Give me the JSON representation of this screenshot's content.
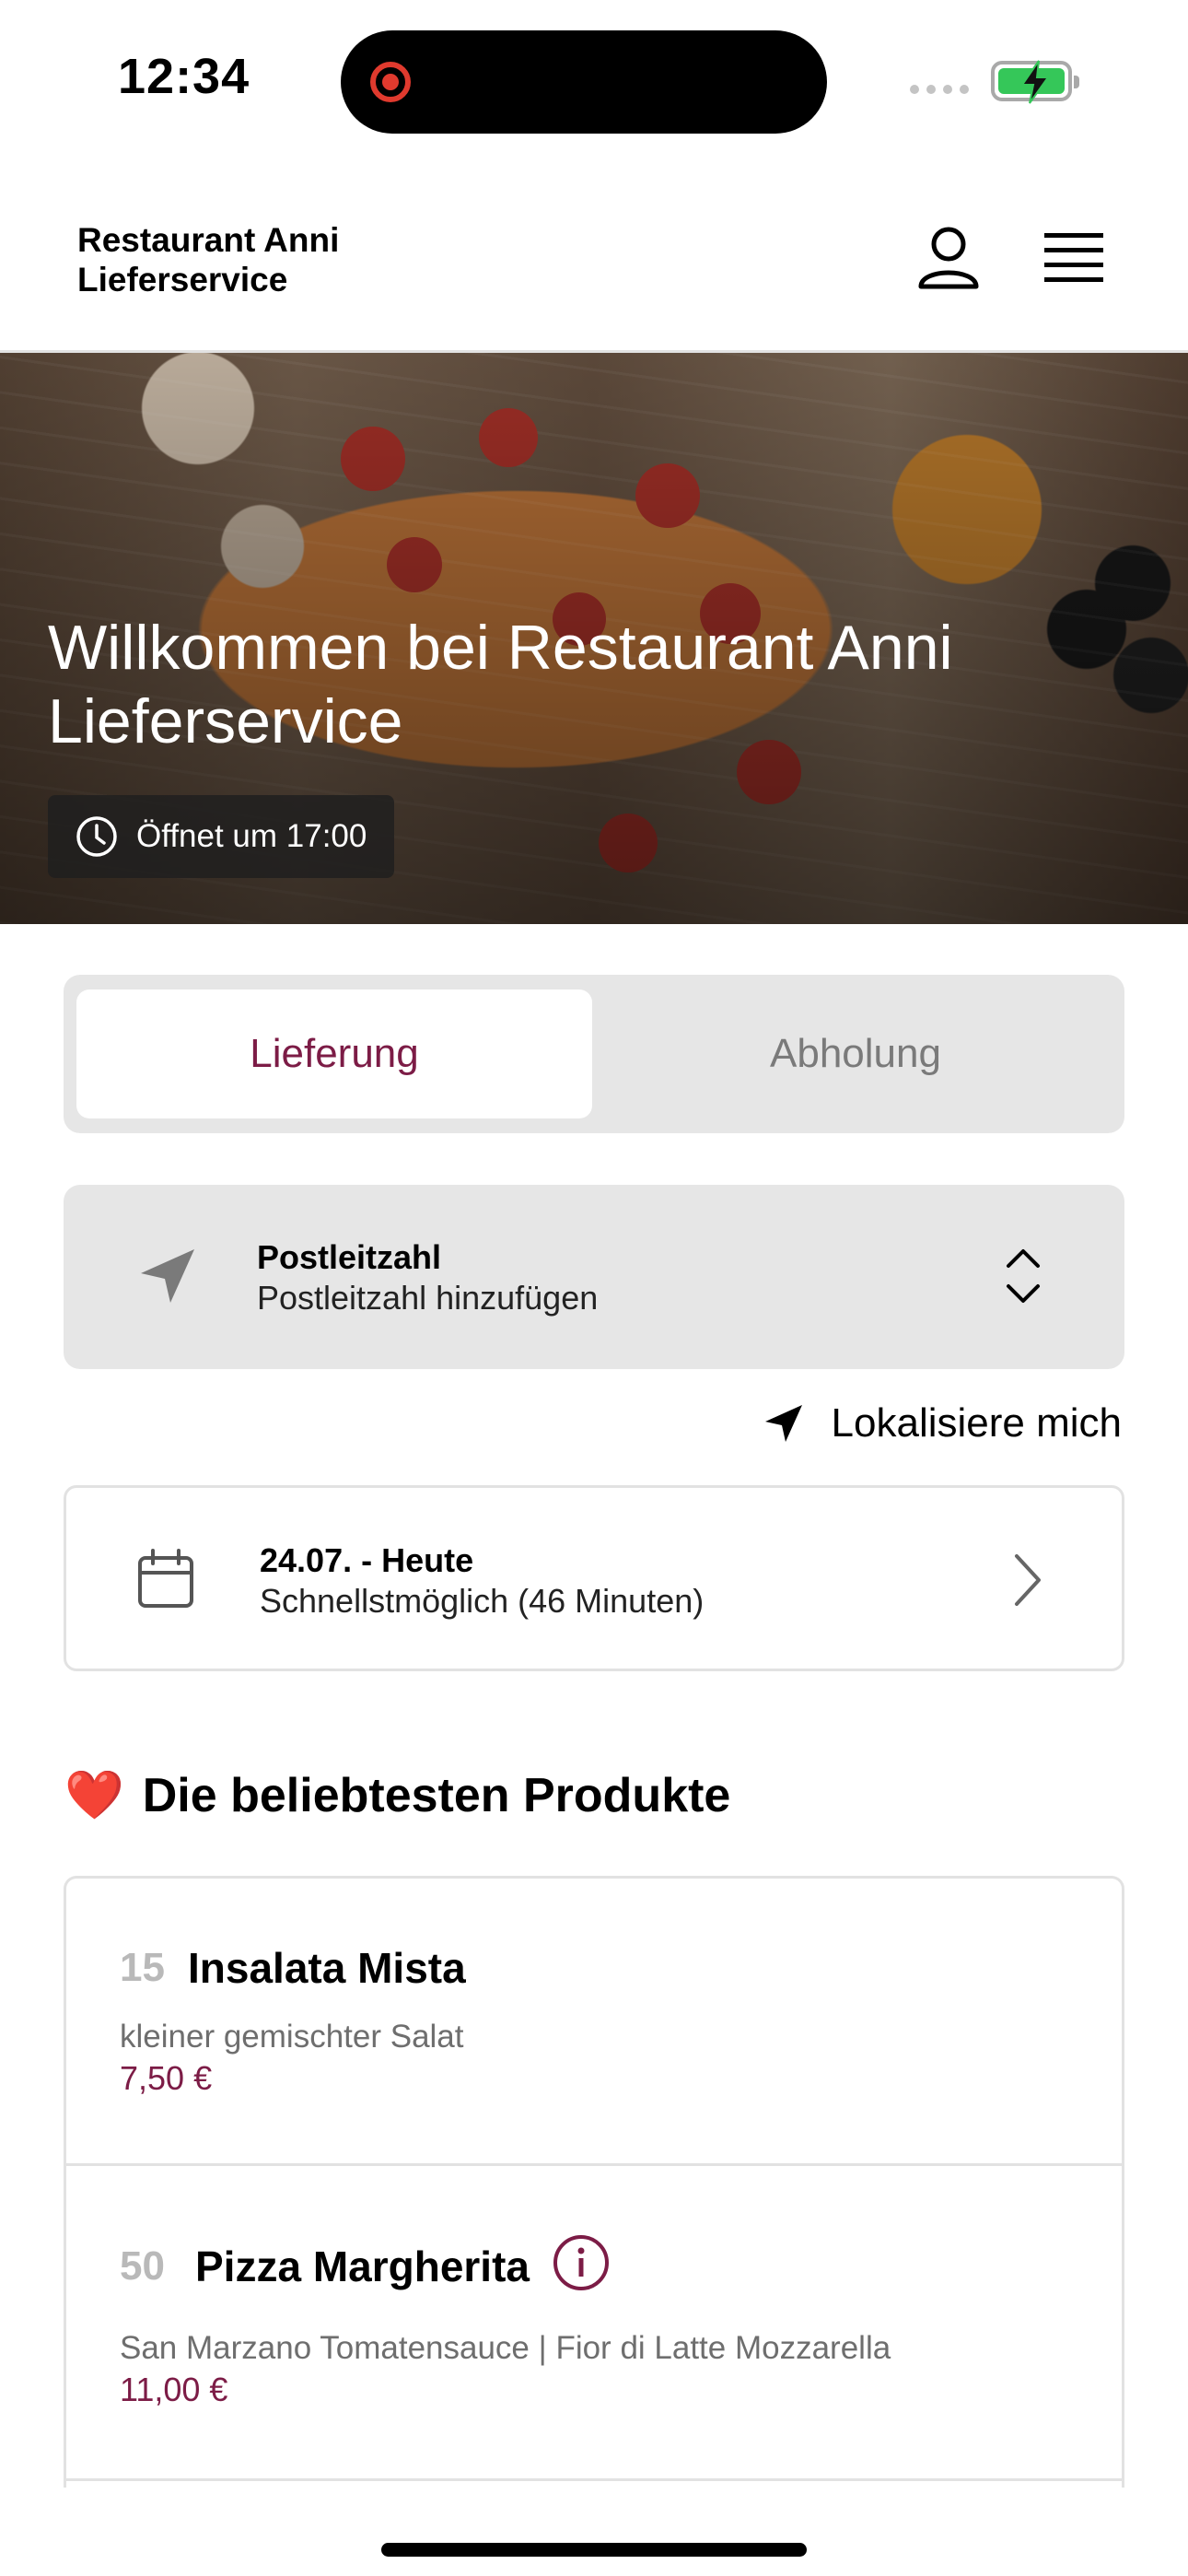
{
  "status_bar": {
    "time": "12:34",
    "recording_color": "#e03a2e",
    "battery_color": "#35c759",
    "battery_state": "charging"
  },
  "header": {
    "brand": "Restaurant Anni Lieferservice",
    "user_icon": "user-icon",
    "menu_icon": "hamburger-menu-icon"
  },
  "hero": {
    "title": "Willkommen bei Restaurant Anni Lieferservice",
    "open_status": "Öffnet um 17:00",
    "clock_icon": "clock-icon"
  },
  "order_mode": {
    "options": [
      "Lieferung",
      "Abholung"
    ],
    "selected": "Lieferung",
    "accent_color": "#7c1c46"
  },
  "postal": {
    "label": "Postleitzahl",
    "value": "Postleitzahl hinzufügen",
    "icon": "location-arrow-icon"
  },
  "locate": {
    "label": "Lokalisiere mich"
  },
  "delivery_time": {
    "date": "24.07. - Heute",
    "time": "Schnellstmöglich (46 Minuten)"
  },
  "popular": {
    "emoji": "❤️",
    "title": "Die beliebtesten Produkte",
    "items": [
      {
        "number": "15",
        "name": "Insalata Mista",
        "description": "kleiner gemischter Salat",
        "price": "7,50 €"
      },
      {
        "number": "50",
        "name": "Pizza Margherita",
        "description": "San Marzano Tomatensauce | Fior di Latte Mozzarella",
        "price": "11,00 €"
      }
    ]
  }
}
